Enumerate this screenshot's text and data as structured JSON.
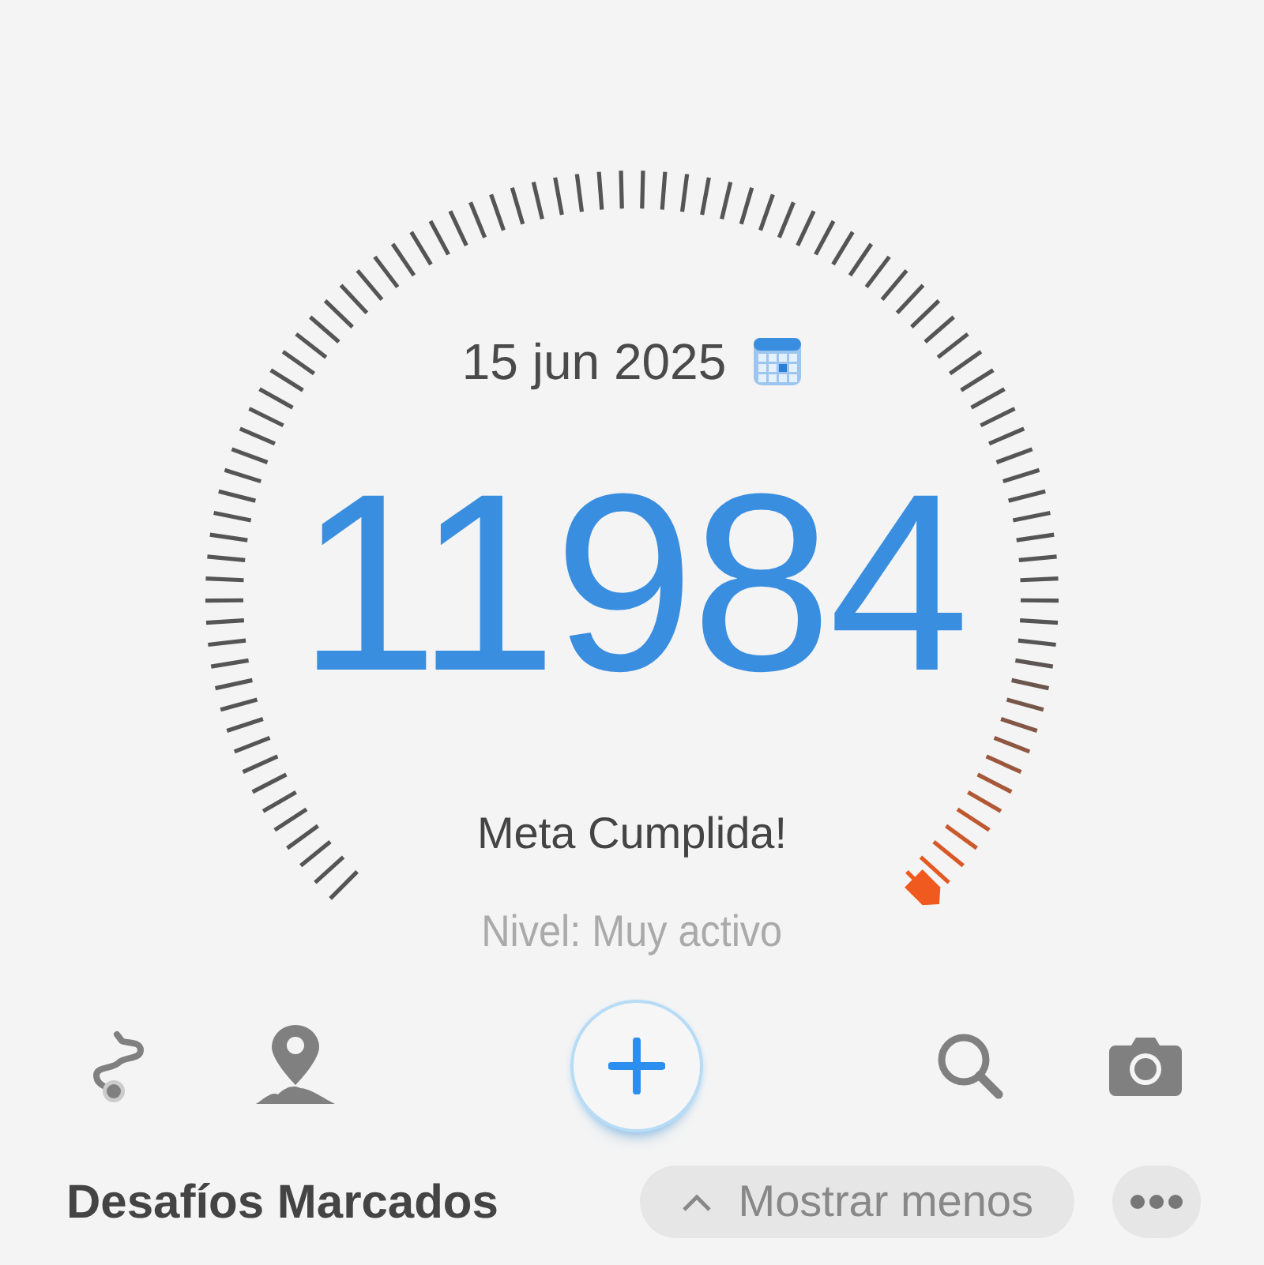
{
  "date": "15 jun 2025",
  "steps": "11984",
  "status": "Meta Cumplida!",
  "activity_level": "Nivel: Muy activo",
  "section": {
    "title": "Desafíos Marcados",
    "toggle": {
      "label": "Mostrar menos",
      "expanded": true
    }
  }
}
